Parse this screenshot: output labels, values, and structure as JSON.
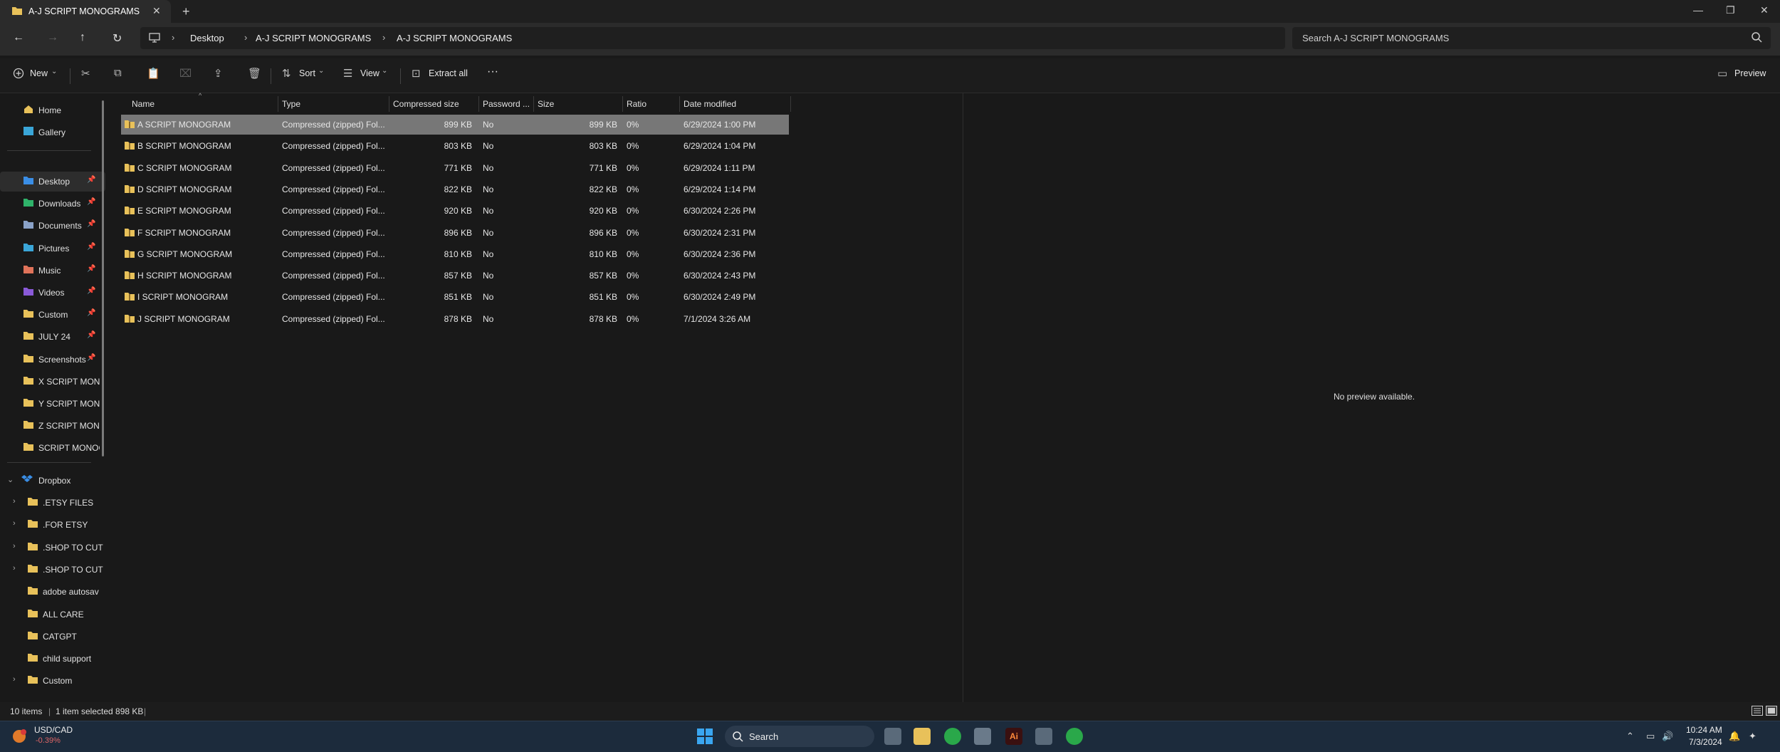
{
  "tab": {
    "title": "A-J SCRIPT MONOGRAMS",
    "close": "✕",
    "new": "+"
  },
  "window": {
    "minimize": "—",
    "maximize": "❐",
    "close": "✕"
  },
  "breadcrumb": [
    "Desktop",
    "A-J SCRIPT MONOGRAMS",
    "A-J SCRIPT MONOGRAMS"
  ],
  "search": {
    "placeholder": "Search A-J SCRIPT MONOGRAMS"
  },
  "toolbar": {
    "new": "New",
    "sort": "Sort",
    "view": "View",
    "extract": "Extract all",
    "more": "···",
    "preview": "Preview"
  },
  "sidebar": {
    "top": [
      {
        "label": "Home"
      },
      {
        "label": "Gallery"
      }
    ],
    "quick": [
      {
        "label": "Desktop",
        "pinned": true,
        "color": "#3a8ee6"
      },
      {
        "label": "Downloads",
        "pinned": true,
        "color": "#2fb36a"
      },
      {
        "label": "Documents",
        "pinned": true,
        "color": "#8aa2c8"
      },
      {
        "label": "Pictures",
        "pinned": true,
        "color": "#3aa6d8"
      },
      {
        "label": "Music",
        "pinned": true,
        "color": "#e0735a"
      },
      {
        "label": "Videos",
        "pinned": true,
        "color": "#8a5ad8"
      },
      {
        "label": "Custom",
        "pinned": true,
        "color": "#e8c15a"
      },
      {
        "label": "JULY 24",
        "pinned": true,
        "color": "#e8c15a"
      },
      {
        "label": "Screenshots",
        "pinned": true,
        "color": "#e8c15a"
      },
      {
        "label": "X SCRIPT MONOG",
        "pinned": false,
        "color": "#e8c15a"
      },
      {
        "label": "Y SCRIPT MONOG",
        "pinned": false,
        "color": "#e8c15a"
      },
      {
        "label": "Z SCRIPT MONOG",
        "pinned": false,
        "color": "#e8c15a"
      },
      {
        "label": "SCRIPT MONOG",
        "pinned": false,
        "color": "#e8c15a"
      }
    ],
    "dropbox": {
      "label": "Dropbox"
    },
    "dropbox_items": [
      {
        "label": ".ETSY FILES",
        "chev": true
      },
      {
        "label": ".FOR ETSY",
        "chev": true
      },
      {
        "label": ".SHOP TO CUT",
        "chev": true
      },
      {
        "label": ".SHOP TO CUT",
        "chev": true
      },
      {
        "label": "adobe autosav",
        "chev": false
      },
      {
        "label": "ALL CARE",
        "chev": false
      },
      {
        "label": "CATGPT",
        "chev": false
      },
      {
        "label": "child support",
        "chev": false
      },
      {
        "label": "Custom",
        "chev": true
      }
    ]
  },
  "columns": [
    "Name",
    "Type",
    "Compressed size",
    "Password ...",
    "Size",
    "Ratio",
    "Date modified"
  ],
  "files": [
    {
      "name": "A SCRIPT MONOGRAM",
      "type": "Compressed (zipped) Fol...",
      "csize": "899 KB",
      "pwd": "No",
      "size": "899 KB",
      "ratio": "0%",
      "date": "6/29/2024 1:00 PM"
    },
    {
      "name": "B SCRIPT MONOGRAM",
      "type": "Compressed (zipped) Fol...",
      "csize": "803 KB",
      "pwd": "No",
      "size": "803 KB",
      "ratio": "0%",
      "date": "6/29/2024 1:04 PM"
    },
    {
      "name": "C SCRIPT MONOGRAM",
      "type": "Compressed (zipped) Fol...",
      "csize": "771 KB",
      "pwd": "No",
      "size": "771 KB",
      "ratio": "0%",
      "date": "6/29/2024 1:11 PM"
    },
    {
      "name": "D SCRIPT MONOGRAM",
      "type": "Compressed (zipped) Fol...",
      "csize": "822 KB",
      "pwd": "No",
      "size": "822 KB",
      "ratio": "0%",
      "date": "6/29/2024 1:14 PM"
    },
    {
      "name": "E SCRIPT MONOGRAM",
      "type": "Compressed (zipped) Fol...",
      "csize": "920 KB",
      "pwd": "No",
      "size": "920 KB",
      "ratio": "0%",
      "date": "6/30/2024 2:26 PM"
    },
    {
      "name": "F SCRIPT MONOGRAM",
      "type": "Compressed (zipped) Fol...",
      "csize": "896 KB",
      "pwd": "No",
      "size": "896 KB",
      "ratio": "0%",
      "date": "6/30/2024 2:31 PM"
    },
    {
      "name": "G SCRIPT MONOGRAM",
      "type": "Compressed (zipped) Fol...",
      "csize": "810 KB",
      "pwd": "No",
      "size": "810 KB",
      "ratio": "0%",
      "date": "6/30/2024 2:36 PM"
    },
    {
      "name": "H SCRIPT MONOGRAM",
      "type": "Compressed (zipped) Fol...",
      "csize": "857 KB",
      "pwd": "No",
      "size": "857 KB",
      "ratio": "0%",
      "date": "6/30/2024 2:43 PM"
    },
    {
      "name": "I SCRIPT MONOGRAM",
      "type": "Compressed (zipped) Fol...",
      "csize": "851 KB",
      "pwd": "No",
      "size": "851 KB",
      "ratio": "0%",
      "date": "6/30/2024 2:49 PM"
    },
    {
      "name": "J SCRIPT MONOGRAM",
      "type": "Compressed (zipped) Fol...",
      "csize": "878 KB",
      "pwd": "No",
      "size": "878 KB",
      "ratio": "0%",
      "date": "7/1/2024 3:26 AM"
    }
  ],
  "preview": {
    "empty": "No preview available."
  },
  "status": {
    "items": "10 items",
    "selected": "1 item selected  898 KB"
  },
  "taskbar": {
    "ticker": "USD/CAD",
    "change": "-0.39%",
    "search": "Search",
    "time": "10:24 AM",
    "date": "7/3/2024"
  }
}
